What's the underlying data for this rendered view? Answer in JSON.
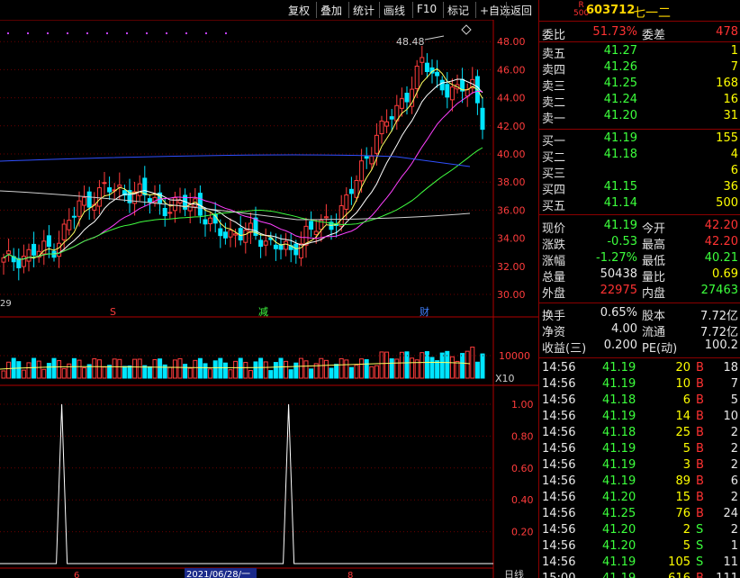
{
  "toolbar": {
    "items": [
      "复权",
      "叠加",
      "统计",
      "画线",
      "F10",
      "标记",
      "+自选",
      "返回"
    ]
  },
  "stock": {
    "badge_top": "R",
    "badge_bottom": "500",
    "code": "603712",
    "name": "七一二"
  },
  "order_ratio": {
    "label1": "委比",
    "value1": "51.73%",
    "label2": "委差",
    "value2": "478"
  },
  "asks": [
    {
      "label": "卖五",
      "price": "41.27",
      "vol": "1"
    },
    {
      "label": "卖四",
      "price": "41.26",
      "vol": "7"
    },
    {
      "label": "卖三",
      "price": "41.25",
      "vol": "168"
    },
    {
      "label": "卖二",
      "price": "41.24",
      "vol": "16"
    },
    {
      "label": "卖一",
      "price": "41.20",
      "vol": "31"
    }
  ],
  "bids": [
    {
      "label": "买一",
      "price": "41.19",
      "vol": "155"
    },
    {
      "label": "买二",
      "price": "41.18",
      "vol": "4"
    },
    {
      "label": "买三",
      "price": "",
      "vol": "6"
    },
    {
      "label": "买四",
      "price": "41.15",
      "vol": "36"
    },
    {
      "label": "买五",
      "price": "41.14",
      "vol": "500"
    }
  ],
  "quote": [
    {
      "l1": "现价",
      "v1": "41.19",
      "c1": "green",
      "l2": "今开",
      "v2": "42.20",
      "c2": "red"
    },
    {
      "l1": "涨跌",
      "v1": "-0.53",
      "c1": "green",
      "l2": "最高",
      "v2": "42.20",
      "c2": "red"
    },
    {
      "l1": "涨幅",
      "v1": "-1.27%",
      "c1": "green",
      "l2": "最低",
      "v2": "40.21",
      "c2": "green"
    },
    {
      "l1": "总量",
      "v1": "50438",
      "c1": "white",
      "l2": "量比",
      "v2": "0.69",
      "c2": "yellow"
    },
    {
      "l1": "外盘",
      "v1": "22975",
      "c1": "red",
      "l2": "内盘",
      "v2": "27463",
      "c2": "green"
    }
  ],
  "stats": [
    {
      "l1": "换手",
      "v1": "0.65%",
      "l2": "股本",
      "v2": "7.72亿"
    },
    {
      "l1": "净资",
      "v1": "4.00",
      "l2": "流通",
      "v2": "7.72亿"
    },
    {
      "l1": "收益(三)",
      "v1": "0.200",
      "l2": "PE(动)",
      "v2": "100.2"
    }
  ],
  "ticks": [
    {
      "t": "14:56",
      "p": "41.19",
      "v": "20",
      "s": "B",
      "n": "18"
    },
    {
      "t": "14:56",
      "p": "41.19",
      "v": "10",
      "s": "B",
      "n": "7"
    },
    {
      "t": "14:56",
      "p": "41.18",
      "v": "6",
      "s": "B",
      "n": "5"
    },
    {
      "t": "14:56",
      "p": "41.19",
      "v": "14",
      "s": "B",
      "n": "10"
    },
    {
      "t": "14:56",
      "p": "41.18",
      "v": "25",
      "s": "B",
      "n": "2"
    },
    {
      "t": "14:56",
      "p": "41.19",
      "v": "5",
      "s": "B",
      "n": "2"
    },
    {
      "t": "14:56",
      "p": "41.19",
      "v": "3",
      "s": "B",
      "n": "2"
    },
    {
      "t": "14:56",
      "p": "41.19",
      "v": "89",
      "s": "B",
      "n": "6"
    },
    {
      "t": "14:56",
      "p": "41.20",
      "v": "15",
      "s": "B",
      "n": "2"
    },
    {
      "t": "14:56",
      "p": "41.25",
      "v": "76",
      "s": "B",
      "n": "24"
    },
    {
      "t": "14:56",
      "p": "41.20",
      "v": "2",
      "s": "S",
      "n": "2"
    },
    {
      "t": "14:56",
      "p": "41.20",
      "v": "5",
      "s": "S",
      "n": "1"
    },
    {
      "t": "14:56",
      "p": "41.19",
      "v": "105",
      "s": "S",
      "n": "11"
    },
    {
      "t": "15:00",
      "p": "41.19",
      "v": "616",
      "s": "B",
      "n": "111"
    }
  ],
  "chart": {
    "price_axis": [
      "48.00",
      "46.00",
      "44.00",
      "42.00",
      "40.00",
      "38.00",
      "36.00",
      "34.00",
      "32.00",
      "30.00"
    ],
    "high_label": "48.48",
    "low_label": "29",
    "markers": [
      "S",
      "减",
      "财"
    ],
    "vol_axis": "10000",
    "vol_unit": "X10",
    "ind_axis": [
      "1.00",
      "0.80",
      "0.60",
      "0.40",
      "0.20"
    ],
    "x_labels": [
      "6",
      "2021/06/28/一",
      "8"
    ],
    "period": "日线"
  },
  "chart_data": {
    "type": "candlestick",
    "price_range": [
      29.5,
      49.0
    ],
    "note_ma": "MA5 yellow, MA10 white, MA20 magenta, MA60 green, MA120 gray, MA250 blue",
    "indicator": {
      "range": [
        0,
        1.05
      ],
      "peaks_index": [
        11,
        56
      ]
    }
  }
}
